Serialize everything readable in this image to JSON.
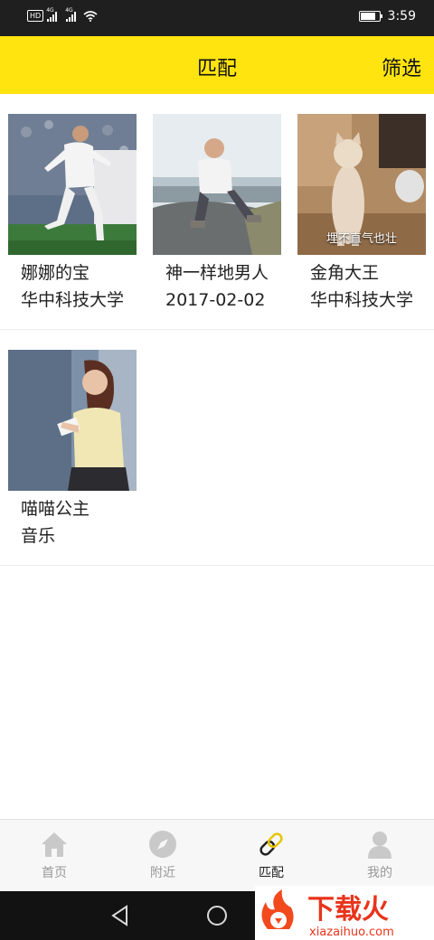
{
  "status_bar": {
    "hd": "HD",
    "network_1": "4G",
    "network_2": "4G",
    "time": "3:59",
    "battery_level": 0.8
  },
  "header": {
    "title": "匹配",
    "filter_label": "筛选",
    "color": "#FFE40F"
  },
  "cards": [
    {
      "name": "娜娜的宝",
      "sub": "华中科技大学",
      "caption": ""
    },
    {
      "name": "神一样地男人",
      "sub": "2017-02-02",
      "caption": ""
    },
    {
      "name": "金角大王",
      "sub": "华中科技大学",
      "caption": "埋不直气也壮"
    },
    {
      "name": "喵喵公主",
      "sub": "音乐",
      "caption": ""
    }
  ],
  "tabs": [
    {
      "label": "首页",
      "icon": "home-icon",
      "active": false
    },
    {
      "label": "附近",
      "icon": "compass-icon",
      "active": false
    },
    {
      "label": "匹配",
      "icon": "link-icon",
      "active": true
    },
    {
      "label": "我的",
      "icon": "person-icon",
      "active": false
    }
  ],
  "nav": [
    "back-icon",
    "home-circle-icon"
  ],
  "watermark": {
    "brand": "下载火",
    "url": "xiazaihuo.com"
  }
}
